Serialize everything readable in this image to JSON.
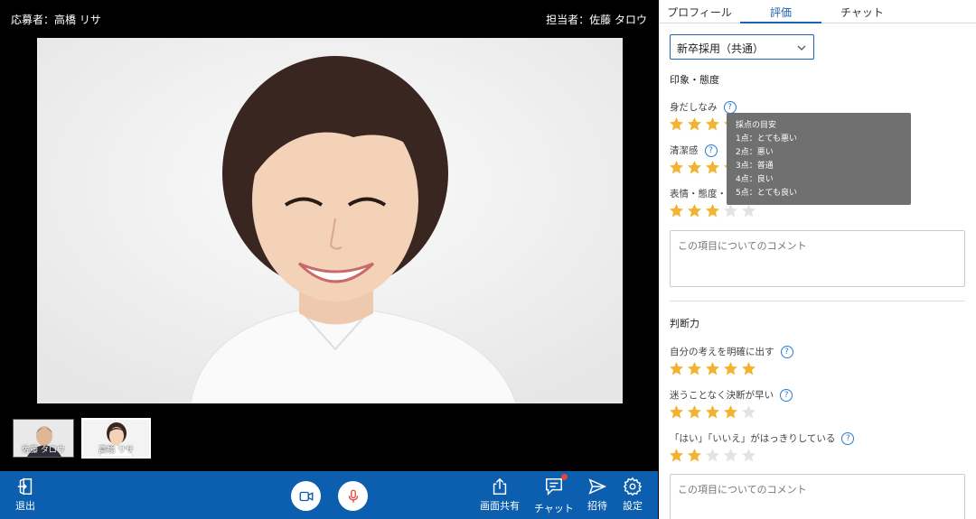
{
  "video": {
    "applicant_label": "応募者：高橋 リサ",
    "interviewer_label": "担当者：佐藤 タロウ",
    "thumbnails": [
      {
        "name": "佐藤 タロウ"
      },
      {
        "name": "高橋 リサ"
      }
    ]
  },
  "toolbar": {
    "exit_label": "退出",
    "share_label": "画面共有",
    "chat_label": "チャット",
    "invite_label": "招待",
    "settings_label": "設定"
  },
  "panel": {
    "tabs": [
      {
        "label": "プロフィール"
      },
      {
        "label": "評価"
      },
      {
        "label": "チャット"
      }
    ],
    "active_tab": "評価",
    "template_select": "新卒採用（共通）",
    "sections": [
      {
        "title": "印象・態度",
        "criteria": [
          {
            "label": "身だしなみ",
            "rating": 5
          },
          {
            "label": "清潔感",
            "rating": 5
          },
          {
            "label": "表情・態度・",
            "rating": 3
          }
        ],
        "comment_placeholder": "この項目についてのコメント"
      },
      {
        "title": "判断力",
        "criteria": [
          {
            "label": "自分の考えを明確に出す",
            "rating": 5
          },
          {
            "label": "迷うことなく決断が早い",
            "rating": 4
          },
          {
            "label": "「はい」「いいえ」がはっきりしている",
            "rating": 2
          }
        ],
        "comment_placeholder": "この項目についてのコメント"
      }
    ],
    "tooltip": {
      "title": "採点の目安",
      "lines": [
        "1点：とても悪い",
        "2点：悪い",
        "3点：普通",
        "4点：良い",
        "5点：とても良い"
      ]
    }
  },
  "colors": {
    "toolbar_bg": "#0b5fae",
    "accent": "#1f63b5",
    "star_on": "#f2b232",
    "star_off": "#e3e3e3",
    "mic": "#e2473b"
  }
}
